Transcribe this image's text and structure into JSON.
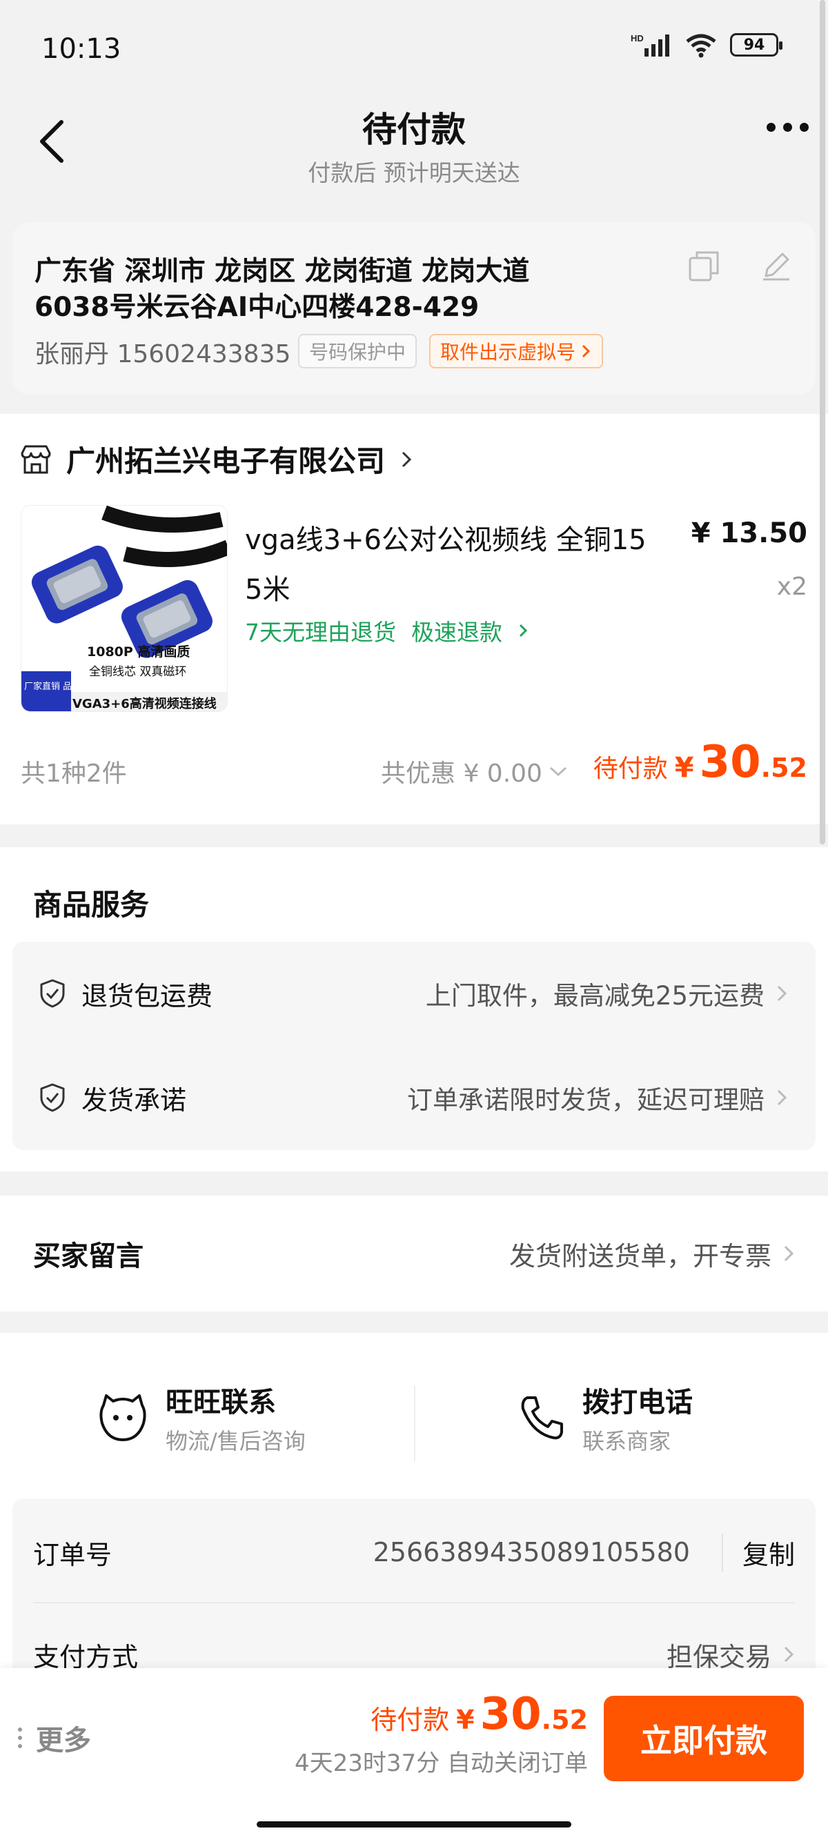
{
  "status_bar": {
    "time": "10:13",
    "battery": "94",
    "network": "HD"
  },
  "header": {
    "title": "待付款",
    "subtitle": "付款后 预计明天送达"
  },
  "address": {
    "line1": "广东省 深圳市 龙岗区 龙岗街道 龙岗大道",
    "line2": "6038号米云谷AI中心四楼428-429",
    "person": "张丽丹 15602433835",
    "protect_badge": "号码保护中",
    "virtual_badge": "取件出示虚拟号"
  },
  "shop": {
    "name": "广州拓兰兴电子有限公司",
    "product": {
      "title_line1": "vga线3+6公对公视频线 全铜15",
      "title_line2": "5米",
      "price": "¥ 13.50",
      "qty": "x2",
      "tag1": "7天无理由退货",
      "tag2": "极速退款",
      "image_text": {
        "top": "1080P 高清画质",
        "mid": "全铜线芯 双真磁环",
        "badge": "厂家直销 品质保证",
        "bottom": "VGA3+6高清视频连接线"
      }
    },
    "count": "共1种2件",
    "discount": "共优惠 ¥ 0.00",
    "total_label": "待付款",
    "total_yen": "¥",
    "total_int": "30",
    "total_dec": ".52"
  },
  "services": {
    "title": "商品服务",
    "items": [
      {
        "label": "退货包运费",
        "value": "上门取件，最高减免25元运费"
      },
      {
        "label": "发货承诺",
        "value": "订单承诺限时发货，延迟可理赔"
      }
    ]
  },
  "buyer_message": {
    "label": "买家留言",
    "value": "发货附送货单，开专票"
  },
  "contact": {
    "wangwang": {
      "title": "旺旺联系",
      "sub": "物流/售后咨询"
    },
    "phone": {
      "title": "拨打电话",
      "sub": "联系商家"
    }
  },
  "order": {
    "number_label": "订单号",
    "number_value": "2566389435089105580",
    "copy_label": "复制",
    "payment_label": "支付方式",
    "payment_value": "担保交易"
  },
  "bottom_bar": {
    "more_label": "更多",
    "price_label": "待付款",
    "yen": "¥",
    "price_int": "30",
    "price_dec": ".52",
    "timer": "4天23时37分 自动关闭订单",
    "pay_button": "立即付款"
  },
  "colors": {
    "accent": "#ff5500",
    "price": "#ff4a00",
    "green": "#1ea35b"
  }
}
